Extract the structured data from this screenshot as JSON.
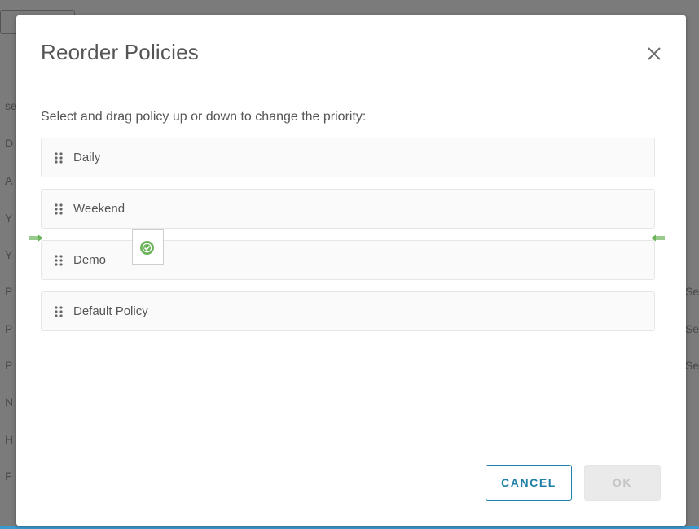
{
  "dialog": {
    "title": "Reorder Policies",
    "instruction": "Select and drag policy up or down to change the priority:",
    "policies": [
      {
        "label": "Daily"
      },
      {
        "label": "Weekend"
      },
      {
        "label": "Demo"
      },
      {
        "label": "Default Policy"
      }
    ],
    "drop_indicator_icon": "check-circle-icon",
    "cancel_label": "CANCEL",
    "ok_label": "OK",
    "accent_color": "#1e7fa8",
    "drop_line_color": "#6cb35b"
  },
  "background": {
    "left_fragments": [
      "se",
      "D",
      "A",
      "Y",
      "Y",
      "P",
      "P",
      "P",
      "N",
      "H",
      "F"
    ],
    "right_fragments": [
      "Se",
      "Se",
      "Se"
    ]
  }
}
